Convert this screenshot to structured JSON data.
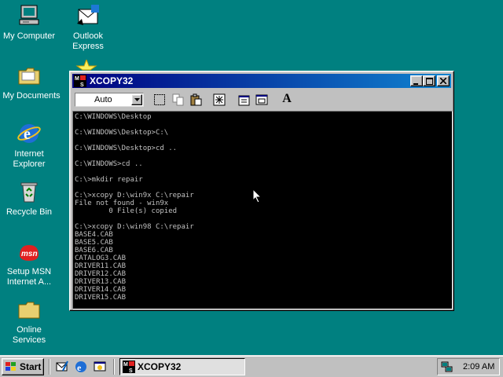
{
  "desktop": {
    "icons": [
      {
        "label": "My Computer"
      },
      {
        "label": "Outlook\nExpress"
      },
      {
        "label": "My Documents"
      },
      {
        "label": "Internet\nExplorer"
      },
      {
        "label": "Recycle Bin"
      },
      {
        "label": "Setup MSN\nInternet A..."
      },
      {
        "label": "Online\nServices"
      }
    ]
  },
  "window": {
    "title": "XCOPY32",
    "font_size_value": "Auto",
    "console_text": "C:\\WINDOWS\\Desktop\n\nC:\\WINDOWS\\Desktop>C:\\\n\nC:\\WINDOWS\\Desktop>cd ..\n\nC:\\WINDOWS>cd ..\n\nC:\\>mkdir repair\n\nC:\\>xcopy D:\\win9x C:\\repair\nFile not found - win9x\n        0 File(s) copied\n\nC:\\>xcopy D:\\win98 C:\\repair\nBASE4.CAB\nBASE5.CAB\nBASE6.CAB\nCATALOG3.CAB\nDRIVER11.CAB\nDRIVER12.CAB\nDRIVER13.CAB\nDRIVER14.CAB\nDRIVER15.CAB\n_"
  },
  "taskbar": {
    "start_label": "Start",
    "task_label": "XCOPY32",
    "clock": "2:09 AM"
  },
  "colors": {
    "desktop": "#008080",
    "title_active": "#000080",
    "console_bg": "#000000",
    "console_fg": "#c0c0c0"
  }
}
